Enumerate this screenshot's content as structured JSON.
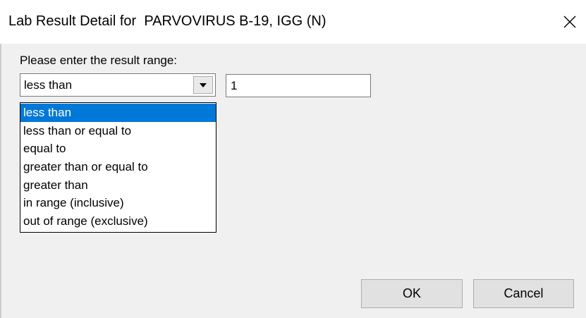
{
  "window": {
    "title": "Lab Result Detail for  PARVOVIRUS B-19, IGG (N)",
    "close_icon": "close-icon"
  },
  "form": {
    "prompt": "Please enter the result range:",
    "operator": {
      "selected": "less than",
      "icon": "chevron-down-icon",
      "options": [
        "less than",
        "less than or equal to",
        "equal to",
        "greater than or equal to",
        "greater than",
        "in range (inclusive)",
        "out of range (exclusive)"
      ],
      "highlighted_index": 0
    },
    "value": "1"
  },
  "buttons": {
    "ok": "OK",
    "cancel": "Cancel"
  },
  "colors": {
    "selection": "#0078d7",
    "window_bg": "#f0f0f0",
    "title_bg": "#ffffff"
  }
}
